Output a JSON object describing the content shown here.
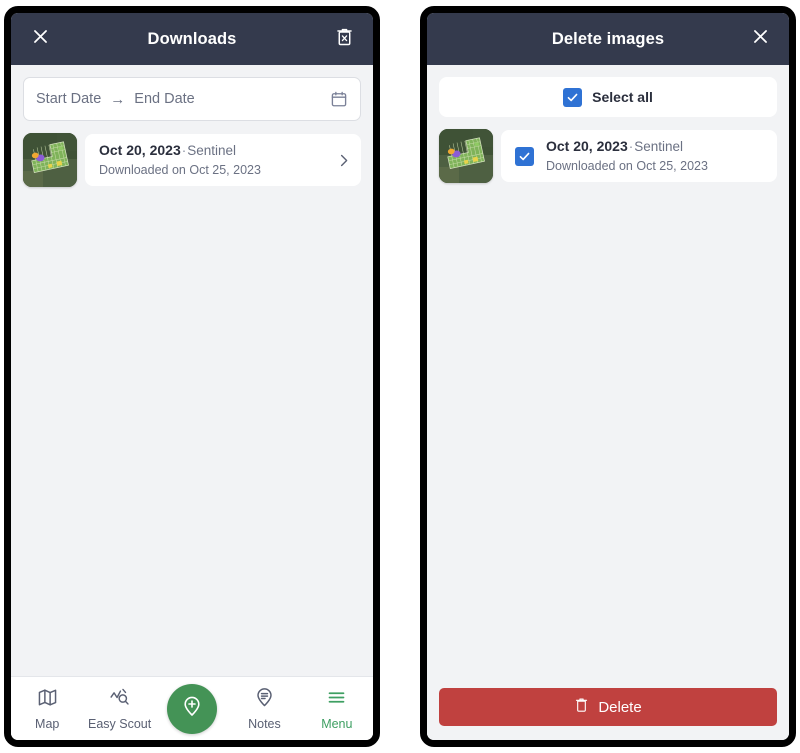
{
  "downloads_panel": {
    "header": {
      "title": "Downloads",
      "close_icon": "close-icon",
      "delete_all_icon": "trash-x-icon"
    },
    "date_range": {
      "start_placeholder": "Start Date",
      "arrow": "→",
      "end_placeholder": "End Date",
      "calendar_icon": "calendar-icon"
    },
    "items": [
      {
        "date": "Oct 20, 2023",
        "separator": "·",
        "source": "Sentinel",
        "downloaded": "Downloaded on Oct 25, 2023",
        "chevron_icon": "chevron-right-icon",
        "thumbnail": "field-map-thumbnail"
      }
    ],
    "bottom_nav": [
      {
        "label": "Map",
        "icon": "map-icon",
        "active": false
      },
      {
        "label": "Easy Scout",
        "icon": "scout-search-icon",
        "active": false
      },
      {
        "label": "Notes",
        "icon": "note-pin-icon",
        "active": false
      },
      {
        "label": "Menu",
        "icon": "hamburger-icon",
        "active": true
      }
    ],
    "fab": {
      "icon": "add-pin-icon",
      "label": ""
    }
  },
  "delete_panel": {
    "header": {
      "title": "Delete images",
      "close_icon": "close-icon"
    },
    "select_all": {
      "label": "Select all",
      "checked": true
    },
    "items": [
      {
        "date": "Oct 20, 2023",
        "separator": "·",
        "source": "Sentinel",
        "downloaded": "Downloaded on Oct 25, 2023",
        "checked": true,
        "thumbnail": "field-map-thumbnail"
      }
    ],
    "delete_button": {
      "label": "Delete",
      "icon": "trash-icon"
    }
  },
  "colors": {
    "appbar": "#343a4d",
    "background": "#f2f3f5",
    "accent_green": "#449356",
    "checkbox_blue": "#2f72d4",
    "delete_red": "#c0413f",
    "text_primary": "#2b2f3d",
    "text_secondary": "#6b7183"
  }
}
